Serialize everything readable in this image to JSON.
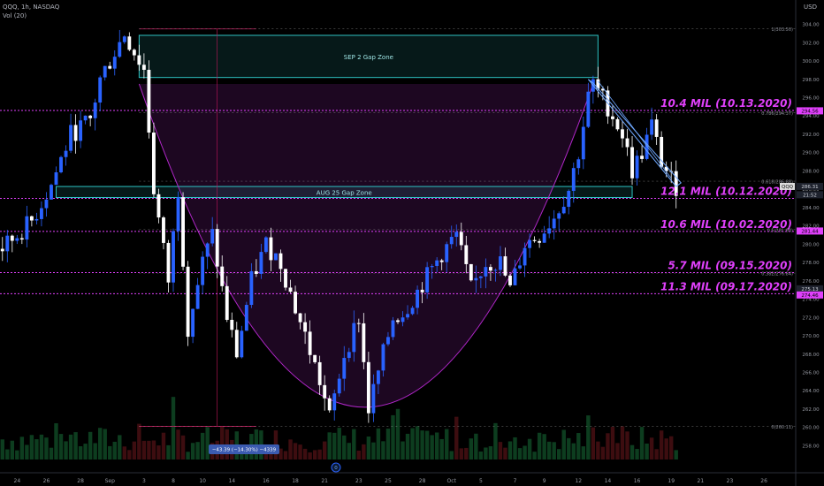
{
  "header": {
    "symbol_line": "QQQ, 1h, NASDAQ",
    "vol_line": "Vol (20)",
    "currency": "USD"
  },
  "colors": {
    "background": "#000000",
    "candle_up": "#2962ff",
    "candle_down": "#ffffff",
    "volume_up": "#0d3d1f",
    "volume_down": "#3d0d10",
    "dotted_level": "#e040fb",
    "cup_curve": "#b026c8",
    "gap_box": "#2ec4c4",
    "fib": "#9e9e9e",
    "callout": "#e040fb"
  },
  "chart_data": {
    "type": "candlestick",
    "title": "",
    "xlabel": "",
    "ylabel": "",
    "ylim": [
      256.5,
      305.5
    ],
    "y_ticks": [
      258,
      260,
      262,
      264,
      266,
      268,
      270,
      272,
      274,
      276,
      278,
      280,
      282,
      284,
      286,
      288,
      290,
      292,
      294,
      296,
      298,
      300,
      302,
      304
    ],
    "x_ticks": [
      {
        "label": "24",
        "bar": 3
      },
      {
        "label": "26",
        "bar": 9
      },
      {
        "label": "28",
        "bar": 16
      },
      {
        "label": "Sep",
        "bar": 22
      },
      {
        "label": "3",
        "bar": 29
      },
      {
        "label": "8",
        "bar": 35
      },
      {
        "label": "10",
        "bar": 41
      },
      {
        "label": "14",
        "bar": 47
      },
      {
        "label": "16",
        "bar": 54
      },
      {
        "label": "18",
        "bar": 60
      },
      {
        "label": "21",
        "bar": 66
      },
      {
        "label": "23",
        "bar": 73
      },
      {
        "label": "25",
        "bar": 79
      },
      {
        "label": "28",
        "bar": 86
      },
      {
        "label": "Oct",
        "bar": 92
      },
      {
        "label": "5",
        "bar": 98
      },
      {
        "label": "7",
        "bar": 105
      },
      {
        "label": "9",
        "bar": 111
      },
      {
        "label": "12",
        "bar": 118
      },
      {
        "label": "14",
        "bar": 124
      },
      {
        "label": "16",
        "bar": 130
      },
      {
        "label": "19",
        "bar": 137
      },
      {
        "label": "21",
        "bar": 143
      },
      {
        "label": "23",
        "bar": 149
      },
      {
        "label": "26",
        "bar": 156
      }
    ],
    "path": [
      {
        "bar": 0,
        "price": 279.5
      },
      {
        "bar": 6,
        "price": 282.5
      },
      {
        "bar": 10,
        "price": 286.5
      },
      {
        "bar": 14,
        "price": 292
      },
      {
        "bar": 18,
        "price": 293.5
      },
      {
        "bar": 20,
        "price": 298
      },
      {
        "bar": 25,
        "price": 303
      },
      {
        "bar": 27,
        "price": 301
      },
      {
        "bar": 29,
        "price": 299
      },
      {
        "bar": 31,
        "price": 286
      },
      {
        "bar": 34,
        "price": 276
      },
      {
        "bar": 36,
        "price": 286
      },
      {
        "bar": 38,
        "price": 271
      },
      {
        "bar": 41,
        "price": 278
      },
      {
        "bar": 43,
        "price": 281
      },
      {
        "bar": 46,
        "price": 272
      },
      {
        "bar": 48,
        "price": 268
      },
      {
        "bar": 51,
        "price": 276
      },
      {
        "bar": 54,
        "price": 280
      },
      {
        "bar": 57,
        "price": 278
      },
      {
        "bar": 60,
        "price": 273
      },
      {
        "bar": 62,
        "price": 270
      },
      {
        "bar": 65,
        "price": 265
      },
      {
        "bar": 67,
        "price": 261
      },
      {
        "bar": 70,
        "price": 268
      },
      {
        "bar": 73,
        "price": 272
      },
      {
        "bar": 75,
        "price": 262
      },
      {
        "bar": 77,
        "price": 266
      },
      {
        "bar": 80,
        "price": 272
      },
      {
        "bar": 82,
        "price": 272.5
      },
      {
        "bar": 84,
        "price": 274
      },
      {
        "bar": 87,
        "price": 276.5
      },
      {
        "bar": 90,
        "price": 279
      },
      {
        "bar": 93,
        "price": 281
      },
      {
        "bar": 96,
        "price": 275
      },
      {
        "bar": 99,
        "price": 278
      },
      {
        "bar": 102,
        "price": 278
      },
      {
        "bar": 104,
        "price": 275
      },
      {
        "bar": 107,
        "price": 280
      },
      {
        "bar": 110,
        "price": 281
      },
      {
        "bar": 113,
        "price": 283
      },
      {
        "bar": 116,
        "price": 286
      },
      {
        "bar": 118,
        "price": 290
      },
      {
        "bar": 120,
        "price": 296
      },
      {
        "bar": 121,
        "price": 297.5
      },
      {
        "bar": 124,
        "price": 295
      },
      {
        "bar": 127,
        "price": 292
      },
      {
        "bar": 129,
        "price": 288
      },
      {
        "bar": 131,
        "price": 290
      },
      {
        "bar": 133,
        "price": 293
      },
      {
        "bar": 135,
        "price": 289
      },
      {
        "bar": 137,
        "price": 287
      },
      {
        "bar": 138,
        "price": 286.3
      }
    ],
    "gap_zones": [
      {
        "label": "SEP 2 Gap Zone",
        "from_bar": 28,
        "to_bar": 122,
        "top": 302.8,
        "bottom": 298.2
      },
      {
        "label": "AUG 25 Gap Zone",
        "from_bar": 11,
        "to_bar": 129,
        "top": 286.3,
        "bottom": 285.1
      }
    ],
    "volume_callouts": [
      {
        "label": "10.4 MIL (10.13.2020)",
        "price": 294.6
      },
      {
        "label": "12.1 MIL (10.12.2020)",
        "price": 285.0
      },
      {
        "label": "10.6 MIL (10.02.2020)",
        "price": 281.4
      },
      {
        "label": "5.7 MIL (09.15.2020)",
        "price": 276.9
      },
      {
        "label": "11.3 MIL (09.17.2020)",
        "price": 274.6
      }
    ],
    "price_labels": [
      {
        "text": "294.56",
        "price": 294.56,
        "style": "magenta"
      },
      {
        "text": "286.31",
        "price": 286.31,
        "style": "dark",
        "prefix": "QQQ"
      },
      {
        "text": "21:52",
        "price": 285.4,
        "style": "dark"
      },
      {
        "text": "281.44",
        "price": 281.44,
        "style": "magenta"
      },
      {
        "text": "275.13",
        "price": 275.13,
        "style": "dark"
      },
      {
        "text": "274.46",
        "price": 274.46,
        "style": "magenta"
      }
    ],
    "fib_labels": [
      {
        "text": "1(303.50)",
        "price": 303.5
      },
      {
        "text": "0.786(294.37)",
        "price": 294.37
      },
      {
        "text": "0.618(286.88)",
        "price": 286.88
      },
      {
        "text": "0.5(281.60)",
        "price": 281.6
      },
      {
        "text": "0.382(276.84)",
        "price": 276.84
      },
      {
        "text": "0(260.11)",
        "price": 260.11
      }
    ],
    "measure_label": "−43.39 (−14.30%) −4339",
    "events_marker": "0",
    "cup": {
      "from_bar": 28,
      "to_bar": 121,
      "top_price": 297.5,
      "bottom_bar": 74,
      "bottom_price": 262.2
    }
  }
}
